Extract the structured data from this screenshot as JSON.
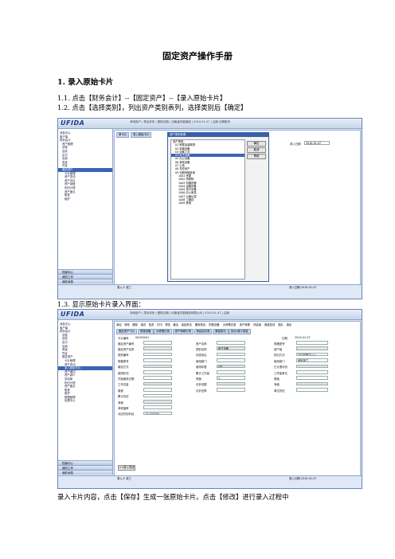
{
  "doc": {
    "title": "固定资产操作手册",
    "section1": "1. 录入原始卡片",
    "step1_1": "1.1. 点击【财务会计】--【固定资产】--【录入原始卡片】",
    "step1_2": "1.2. 点击【选择类别】，列出资产类别表列，选择类别后【确定】",
    "step1_3": "1.3. 显示原始卡片录入界面：",
    "bottom_text": "录入卡片内容，点击【保存】生成一张原始卡片。点击【修改】进行录入过程中"
  },
  "shot1": {
    "logo": "UFIDA",
    "topbar_text": "本网用户 | 导出年份 | 登陆日期 | 河南省华能煤炭 | 2010-01-07 | 注册 切换账号",
    "left_tree": [
      "消息中心",
      "客户端",
      "财务会计",
      "资产管理",
      "总账",
      "应收",
      "应付",
      "出纳",
      "资金",
      "凭证",
      "固定资产",
      "卡片管理",
      "资产变动",
      "资产评估",
      "资产减值",
      "折旧计提",
      "资产盘点",
      "账表",
      "维护"
    ],
    "tabs": [
      "单卡片",
      "录入原始卡片"
    ],
    "dialog_title": "资产类别参照",
    "dialog_items": [
      "资产类别",
      "01 房屋及建筑物",
      "02 机器设备",
      "03 运输工具",
      "04 电子设备",
      "05 办公设备",
      "06 其他设备",
      "07 土地",
      "08 无形资产",
      "09 长期待摊费用",
      "1001 房屋",
      "1002 构筑物",
      "1003 机器设备",
      "1004 运输设备",
      "1005 电子设备",
      "1006 办公家具",
      "1007 仪器仪表",
      "1008 工器具",
      "1009 其他"
    ],
    "dialog_buttons": [
      "确定",
      "取消",
      "帮助"
    ],
    "date_label": "录入日期",
    "date_value": "2010-01-07",
    "bottom_left": "录入人  张三",
    "bottom_right": "录入日期  2010-01-07",
    "left_bottom": [
      "档案中心",
      "我的工作",
      "我的消息"
    ]
  },
  "shot2": {
    "logo": "UFIDA",
    "topbar_text": "本网用户 | 导出年份 | 登陆日期 | 河南省华能煤炭有限公司 | 2010-01-07 | 注册",
    "toolbar": [
      "添加",
      "修改",
      "删除",
      "保存",
      "放弃",
      "打印",
      "预览",
      "输出",
      "增加条目",
      "删除条目",
      "附属设备",
      "大修理记录",
      "资产转移",
      "停启用",
      "原值变动",
      "图片",
      "退出"
    ],
    "card_tabs": [
      "固定资产卡片",
      "附属设备",
      "大修理记录",
      "资产转移记录",
      "停启用记录",
      "原值变动",
      "拆分/减少信息"
    ],
    "card_no_label": "卡片编号",
    "card_no": "00000001",
    "date_label": "日期",
    "date_value": "2010-01-07",
    "labels_col1": [
      "固定资产编号",
      "固定资产名称",
      "类别编号",
      "规格型号",
      "增加方式",
      "使用状况",
      "开始使用日期",
      "工作总量",
      "原值",
      "累计折旧",
      "净值",
      "净残值率",
      "对应折旧科目"
    ],
    "values_col1": [
      "",
      "",
      "",
      "",
      "",
      "",
      "",
      "",
      "",
      "",
      "",
      "",
      "10.000000"
    ],
    "labels_col2": [
      "资产名称",
      "类别名称",
      "存放地点",
      "使用部门",
      "使用年限",
      "累计工作量",
      "残值",
      "月折旧额",
      "月折旧率"
    ],
    "values_col2": [
      "",
      "电子设备",
      "",
      "",
      "0年",
      "",
      "1",
      "",
      ""
    ],
    "labels_col3": [
      "规格型号",
      "资产组",
      "折旧方法",
      "使用部门",
      "已计提月份",
      "工作量单位",
      "原值",
      "净值",
      "单位折旧"
    ],
    "values_col3": [
      "",
      "",
      "平均年限法(一)",
      "使用部门",
      "",
      "",
      "",
      "",
      ""
    ],
    "bottom_button": "<<录入完成",
    "bottom_left": "录入人  张三",
    "bottom_right": "录入日期  2010-01-07",
    "left_tree": [
      "消息中心",
      "客户端",
      "财务会计",
      "总账",
      "应收",
      "应付",
      "出纳",
      "资金",
      "凭证",
      "固定资产",
      "卡片管理",
      "资产变动",
      "录入原始卡片",
      "资产增加",
      "资产减少",
      "变动单",
      "折旧计提",
      "资产盘点",
      "账表",
      "维护",
      "数据管理",
      "处理中心"
    ],
    "left_bottom": [
      "档案中心",
      "我的工作",
      "我的消息"
    ]
  }
}
